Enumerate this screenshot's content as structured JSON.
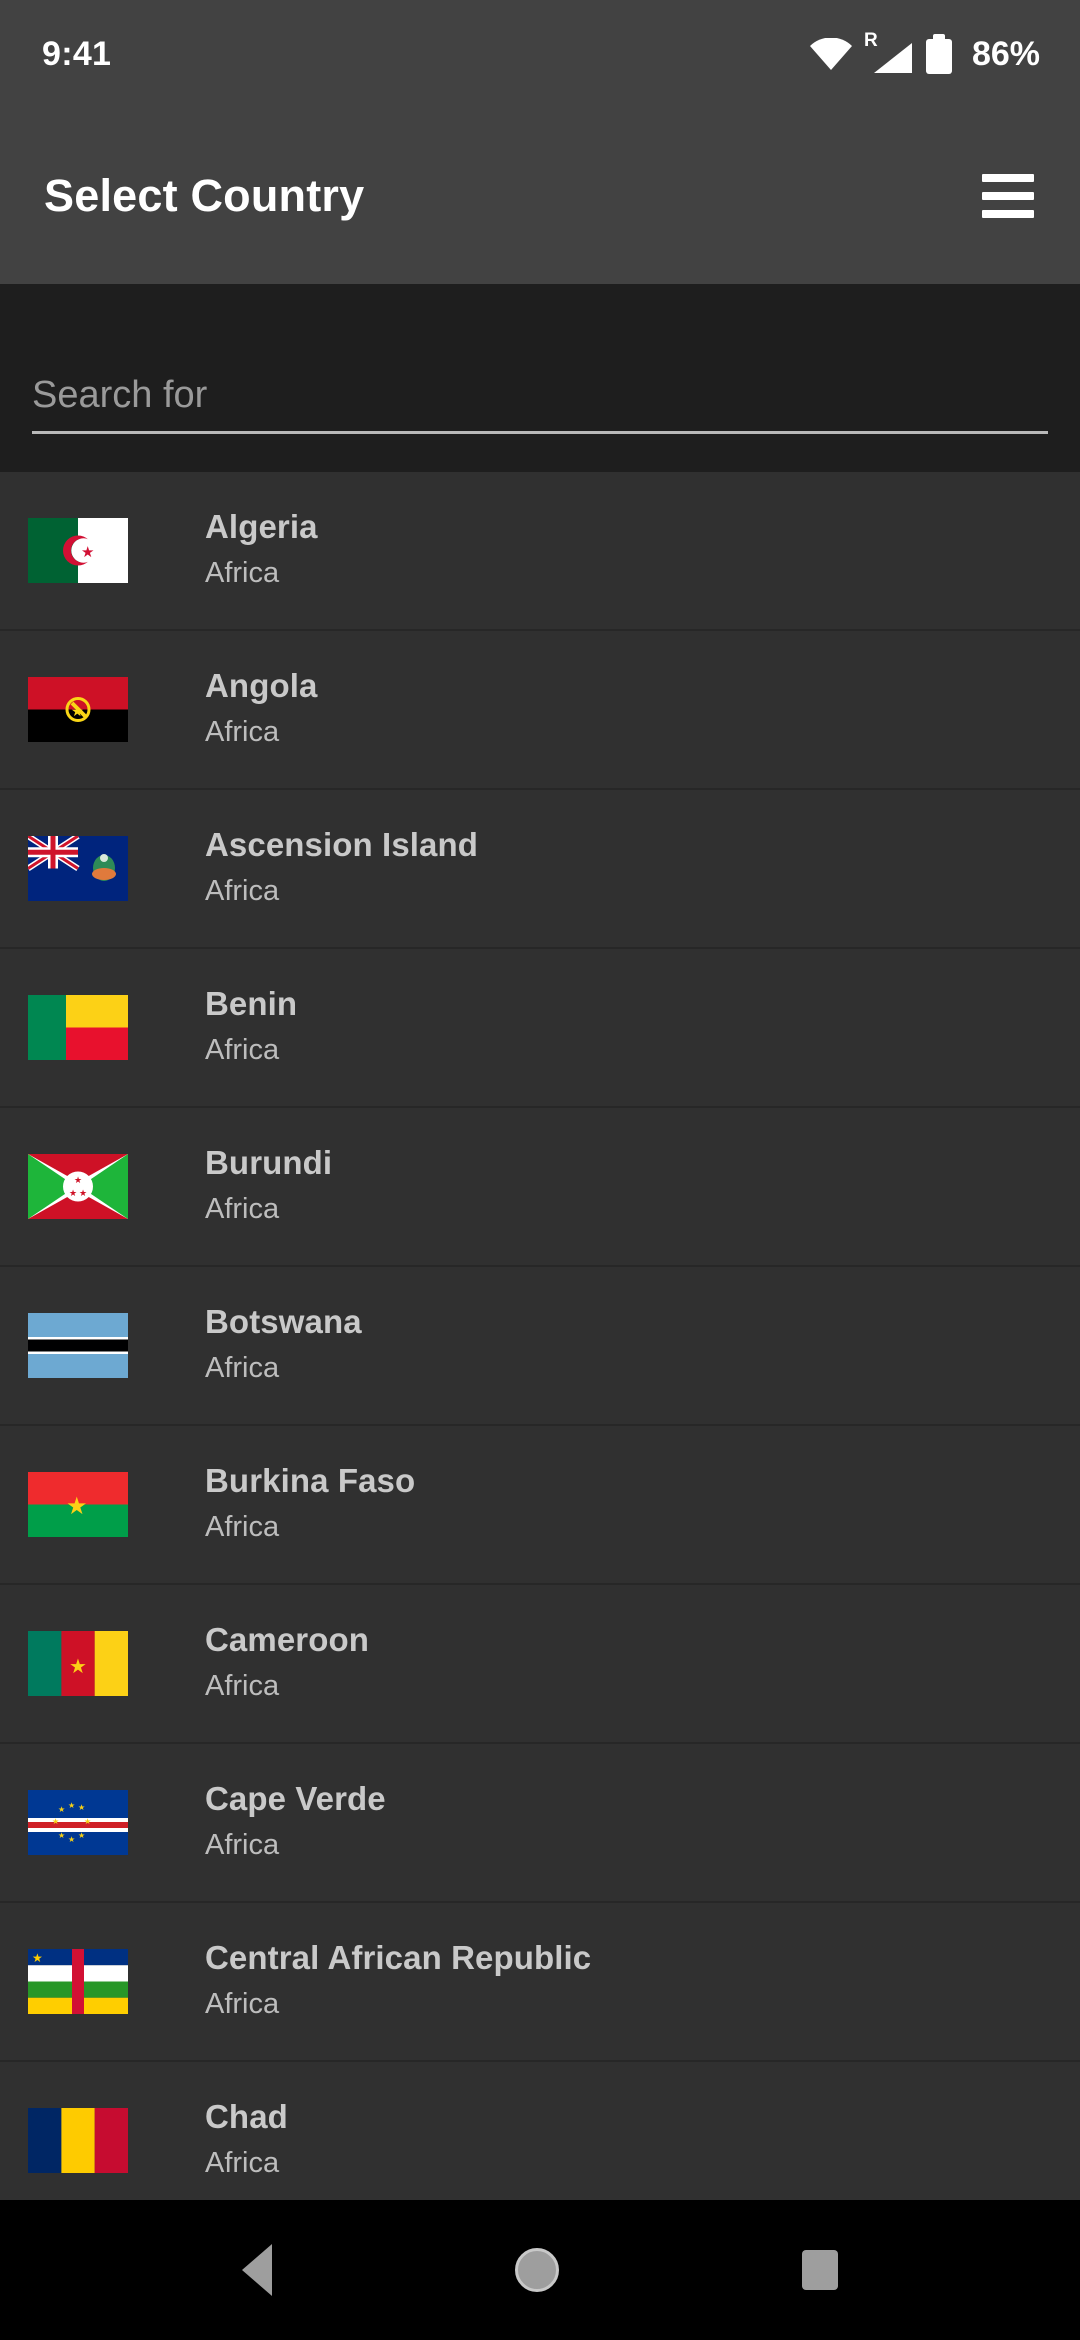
{
  "status_bar": {
    "time": "9:41",
    "roaming_label": "R",
    "battery_percent": "86%",
    "icons": [
      "wifi-icon",
      "cellular-signal-icon",
      "battery-icon"
    ]
  },
  "app_bar": {
    "title": "Select Country",
    "menu_icon": "hamburger-menu-icon"
  },
  "search": {
    "placeholder": "Search for",
    "value": ""
  },
  "nav_bar": {
    "back_label": "back-icon",
    "home_label": "home-icon",
    "recents_label": "recents-icon"
  },
  "colors": {
    "app_bar_bg": "#424242",
    "search_bg": "#1e1e1e",
    "list_bg": "#303030",
    "divider": "#272727",
    "primary_text": "#c9c9c9",
    "secondary_text": "#bdbdbd",
    "nav_bg": "#000000"
  },
  "list": {
    "rows": [
      {
        "name": "Algeria",
        "continent": "Africa",
        "flag": "algeria-flag"
      },
      {
        "name": "Angola",
        "continent": "Africa",
        "flag": "angola-flag"
      },
      {
        "name": "Ascension Island",
        "continent": "Africa",
        "flag": "ascension-island-flag"
      },
      {
        "name": "Benin",
        "continent": "Africa",
        "flag": "benin-flag"
      },
      {
        "name": "Burundi",
        "continent": "Africa",
        "flag": "burundi-flag"
      },
      {
        "name": "Botswana",
        "continent": "Africa",
        "flag": "botswana-flag"
      },
      {
        "name": "Burkina Faso",
        "continent": "Africa",
        "flag": "burkina-faso-flag"
      },
      {
        "name": "Cameroon",
        "continent": "Africa",
        "flag": "cameroon-flag"
      },
      {
        "name": "Cape Verde",
        "continent": "Africa",
        "flag": "cape-verde-flag"
      },
      {
        "name": "Central African Republic",
        "continent": "Africa",
        "flag": "central-african-republic-flag"
      },
      {
        "name": "Chad",
        "continent": "Africa",
        "flag": "chad-flag"
      }
    ]
  }
}
